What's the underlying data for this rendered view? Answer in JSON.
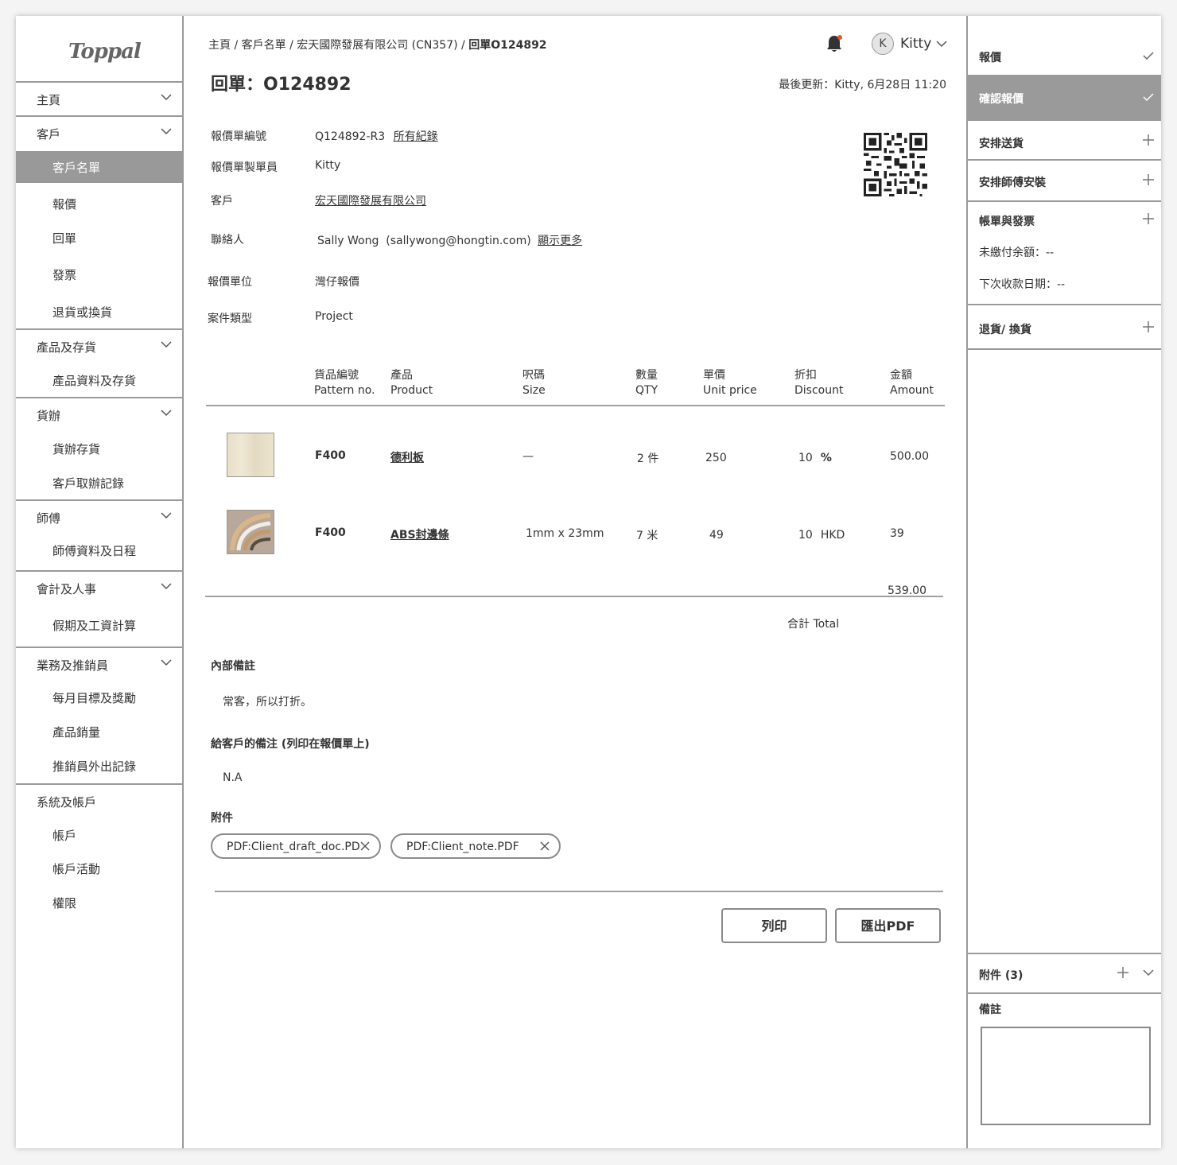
{
  "logo": "Toppal",
  "sidebar": {
    "sections": [
      {
        "label": "主頁",
        "items": []
      },
      {
        "label": "客戶",
        "items": [
          "客戶名單",
          "報價",
          "回單",
          "發票",
          "退貨或換貨"
        ]
      },
      {
        "label": "產品及存貨",
        "items": [
          "產品資料及存貨"
        ]
      },
      {
        "label": "貨辦",
        "items": [
          "貨辦存貨",
          "客戶取辦記錄"
        ]
      },
      {
        "label": "師傅",
        "items": [
          "師傅資料及日程"
        ]
      },
      {
        "label": "會計及人事",
        "items": [
          "假期及工資計算"
        ]
      },
      {
        "label": "業務及推銷員",
        "items": [
          "每月目標及獎勵",
          "產品銷量",
          "推銷員外出記錄"
        ]
      },
      {
        "label": "系統及帳戶",
        "items": [
          "帳戶",
          "帳戶活動",
          "權限"
        ]
      }
    ],
    "active_item": "客戶名單"
  },
  "breadcrumb": {
    "path": "主頁 / 客戶名單 / 宏天國際發展有限公司 (CN357) / ",
    "current": "回單O124892"
  },
  "user": {
    "initial": "K",
    "name": "Kitty"
  },
  "page_title": "回單：O124892",
  "last_updated": "最後更新：Kitty, 6月28日 11:20",
  "fields": {
    "quote_no_label": "報價單編號",
    "quote_no": "Q124892-R3",
    "all_records": "所有紀錄",
    "maker_label": "報價單製單員",
    "maker": "Kitty",
    "customer_label": "客戶",
    "customer": "宏天國際發展有限公司",
    "contact_label": "聯絡人",
    "contact": "Sally Wong  (sallywong@hongtin.com)",
    "show_more": "顯示更多",
    "unit_label": "報價單位",
    "unit": "灣仔報價",
    "case_label": "案件類型",
    "case": "Project"
  },
  "table": {
    "headers": [
      [
        "貨品編號",
        "Pattern no."
      ],
      [
        "產品",
        "Product"
      ],
      [
        "呎碼",
        "Size"
      ],
      [
        "數量",
        "QTY"
      ],
      [
        "單價",
        "Unit price"
      ],
      [
        "折扣",
        "Discount"
      ],
      [
        "金額",
        "Amount"
      ]
    ],
    "rows": [
      {
        "pattern": "F400",
        "product": "德利板",
        "size": "—",
        "qty": "2 件",
        "price": "250",
        "discount": "10",
        "discount_unit": "%",
        "amount": "500.00"
      },
      {
        "pattern": "F400",
        "product": "ABS封邊條",
        "size": "1mm x 23mm",
        "qty": "7 米",
        "price": "49",
        "discount": "10",
        "discount_unit": "HKD",
        "amount": "39"
      }
    ],
    "total_value": "539.00",
    "total_label": "合計 Total"
  },
  "internal_notes": {
    "title": "內部備註",
    "text": "常客，所以打折。"
  },
  "client_notes": {
    "title": "給客戶的備注 (列印在報價單上)",
    "text": "N.A"
  },
  "attachments": {
    "title": "附件",
    "files": [
      "PDF:Client_draft_doc.PD",
      "PDF:Client_note.PDF"
    ]
  },
  "buttons": {
    "print": "列印",
    "export_pdf": "匯出PDF"
  },
  "right_panel": {
    "steps": [
      {
        "label": "報價",
        "icon": "check-icon"
      },
      {
        "label": "確認報價",
        "icon": "check-icon",
        "active": true
      },
      {
        "label": "安排送貨",
        "icon": "plus-icon"
      },
      {
        "label": "安排師傅安裝",
        "icon": "plus-icon"
      },
      {
        "label": "帳單與發票",
        "icon": "plus-icon"
      },
      {
        "label": "退貨/ 換貨",
        "icon": "plus-icon"
      }
    ],
    "unpaid": "未繳付余額：--",
    "next_date": "下次收款日期：--",
    "attachments_label": "附件 (3)",
    "notes_label": "備註"
  }
}
